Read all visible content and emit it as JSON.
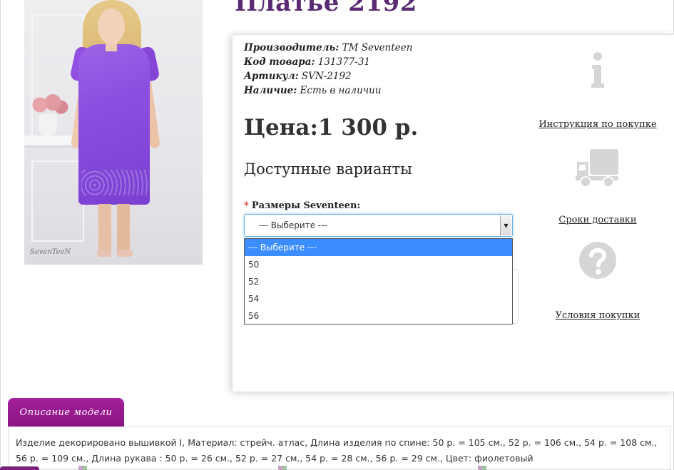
{
  "product": {
    "title": "Платье 2192",
    "photo_signature": "SevenTeeN"
  },
  "meta": {
    "manufacturer_label": "Производитель:",
    "manufacturer_value": "TM Seventeen",
    "code_label": "Код товара:",
    "code_value": "131377-31",
    "article_label": "Артикул:",
    "article_value": "SVN-2192",
    "availability_label": "Наличие:",
    "availability_value": "Есть в наличии"
  },
  "price": {
    "label": "Цена:",
    "value": "1 300 р."
  },
  "options": {
    "title": "Доступные варианты",
    "size_label": "Размеры Seventeen:",
    "required_mark": "*",
    "select_value": "--- Выберите ---",
    "dropdown_options": [
      "--- Выберите ---",
      "50",
      "52",
      "54",
      "56"
    ]
  },
  "side_links": {
    "info": "Инструкция по покупке",
    "delivery": "Сроки доставки",
    "terms": "Условия покупки"
  },
  "description": {
    "tab_label": "Описание модели",
    "text": "Изделие декорировано вышивкой I, Материал: стрейч. атлас, Длина изделия по спине: 50 р. = 105 см., 52 р. = 106 см., 54 р. = 108 см., 56 р. = 109 см., Длина рукава : 50 р. = 26 см., 52 р. = 27 см., 54 р. = 28 см., 56 р. = 29 см., Цвет: фиолетовый"
  },
  "colors": {
    "title": "#5a2a73",
    "tab": "#a4209a",
    "dropdown_selected": "#3c8dff",
    "icon_gray": "#d6d6d6"
  },
  "icons": {
    "info": "info-icon",
    "delivery": "truck-icon",
    "terms": "question-icon",
    "select_arrow": "chevron-down-icon"
  }
}
